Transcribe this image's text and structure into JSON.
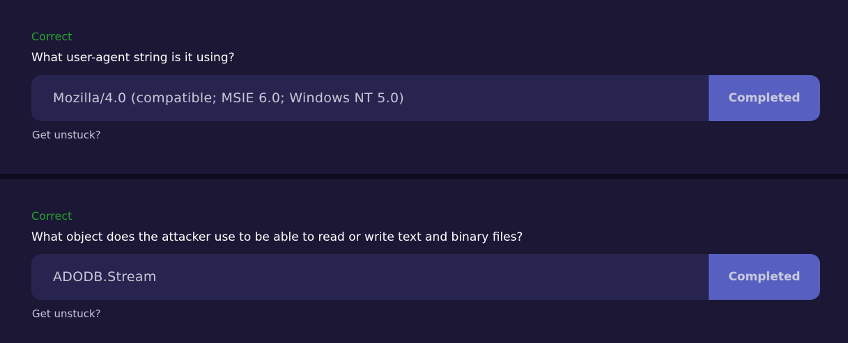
{
  "questions": [
    {
      "status": "Correct",
      "question": "What user-agent string is it using?",
      "answer": "Mozilla/4.0 (compatible; MSIE 6.0; Windows NT 5.0)",
      "button_label": "Completed",
      "hint_link": "Get unstuck?"
    },
    {
      "status": "Correct",
      "question": "What object does the attacker use to be able to read or write text and binary files?",
      "answer": "ADODB.Stream",
      "button_label": "Completed",
      "hint_link": "Get unstuck?"
    }
  ],
  "colors": {
    "status_correct": "#27a32b",
    "button_bg": "#5760c0",
    "field_bg": "#27244f",
    "card_bg": "#1b1735"
  }
}
